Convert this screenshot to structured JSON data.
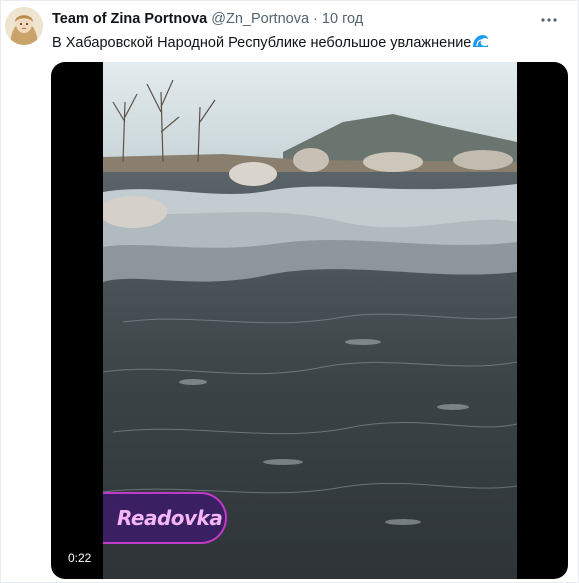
{
  "tweet": {
    "display_name": "Team of Zina Portnova",
    "handle": "@Zn_Portnova",
    "separator": "·",
    "time": "10 год",
    "text": "В Хабаровской Народной Республике небольшое увлажнение",
    "emoji_icon": "water-wave-icon"
  },
  "media": {
    "type": "video",
    "timecode": "0:22",
    "watermark_text": "Readovka"
  },
  "colors": {
    "name": "#0f1419",
    "secondary": "#536471",
    "water_wave": "#1d9bf0",
    "watermark_border": "#c039c9",
    "watermark_bg": "#3b1f63"
  }
}
